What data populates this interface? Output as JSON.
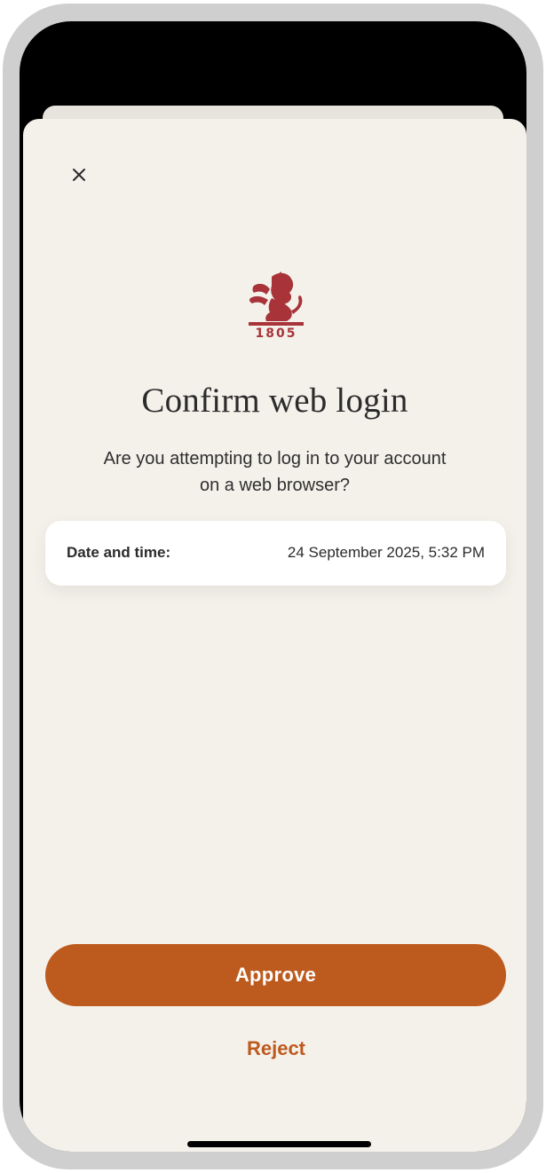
{
  "screen": {
    "title": "Confirm web login",
    "subtitle": "Are you attempting to log in to your account on a web browser?"
  },
  "logo": {
    "icon": "lion-crest-icon",
    "year": "1805",
    "color": "#a8343a"
  },
  "close": {
    "icon": "close-icon",
    "glyph": "×"
  },
  "details": {
    "label": "Date and time:",
    "value": "24 September 2025, 5:32 PM"
  },
  "actions": {
    "approve_label": "Approve",
    "reject_label": "Reject"
  },
  "colors": {
    "accent": "#bd5a1e",
    "background": "#f4f1eb",
    "card": "#ffffff",
    "brand": "#a8343a"
  }
}
